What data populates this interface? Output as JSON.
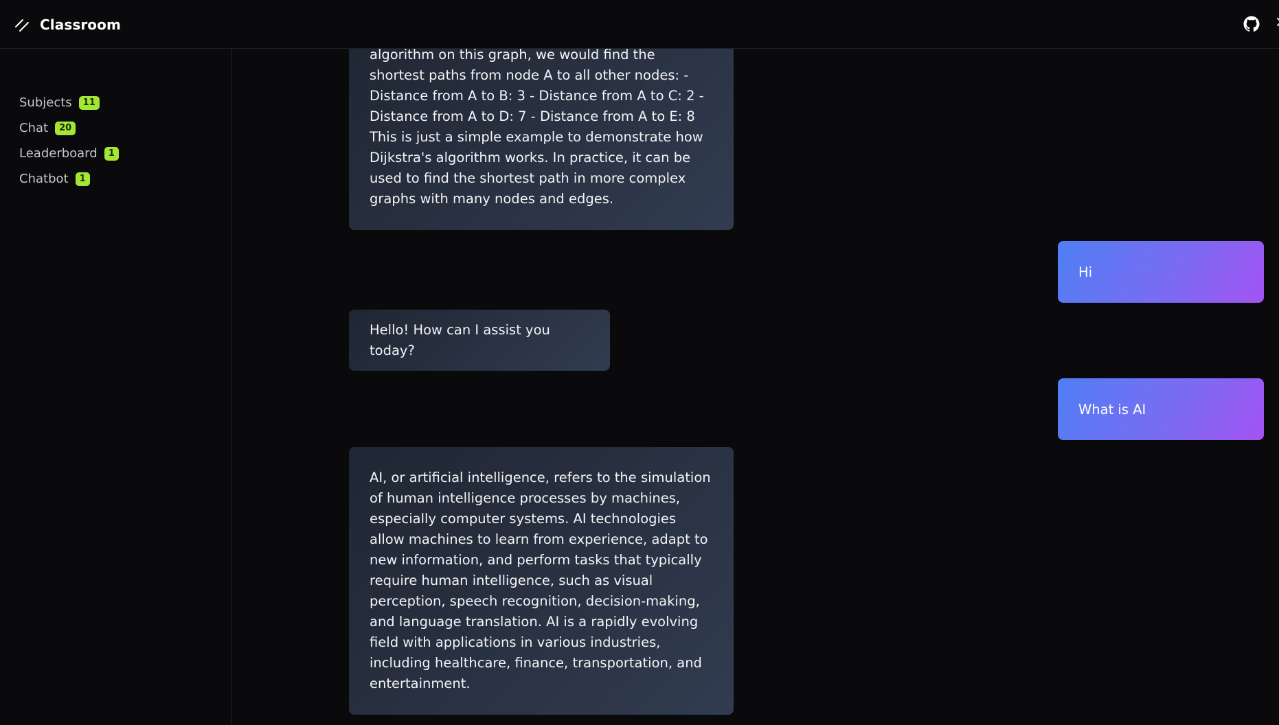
{
  "app": {
    "title": "Classroom"
  },
  "topbar": {
    "github_icon": "github-icon",
    "close_icon": "close-icon"
  },
  "sidebar": {
    "items": [
      {
        "label": "Subjects",
        "badge": "11"
      },
      {
        "label": "Chat",
        "badge": "20"
      },
      {
        "label": "Leaderboard",
        "badge": "1"
      },
      {
        "label": "Chatbot",
        "badge": "1"
      }
    ]
  },
  "chat": {
    "messages": [
      {
        "role": "bot",
        "text": "algorithm on this graph, we would find the shortest paths from node A to all other nodes: - Distance from A to B: 3 - Distance from A to C: 2 - Distance from A to D: 7 - Distance from A to E: 8 This is just a simple example to demonstrate how Dijkstra's algorithm works. In practice, it can be used to find the shortest path in more complex graphs with many nodes and edges."
      },
      {
        "role": "user",
        "text": "Hi"
      },
      {
        "role": "bot",
        "text": "Hello! How can I assist you today?"
      },
      {
        "role": "user",
        "text": "What is AI"
      },
      {
        "role": "bot",
        "text": "AI, or artificial intelligence, refers to the simulation of human intelligence processes by machines, especially computer systems. AI technologies allow machines to learn from experience, adapt to new information, and perform tasks that typically require human intelligence, such as visual perception, speech recognition, decision-making, and language translation. AI is a rapidly evolving field with applications in various industries, including healthcare, finance, transportation, and entertainment."
      }
    ]
  },
  "colors": {
    "background": "#0a0a0c",
    "badge": "#a3e635",
    "bot_bubble": "#2a3243",
    "user_bubble_start": "#4f7ff5",
    "user_bubble_end": "#a353f2"
  }
}
